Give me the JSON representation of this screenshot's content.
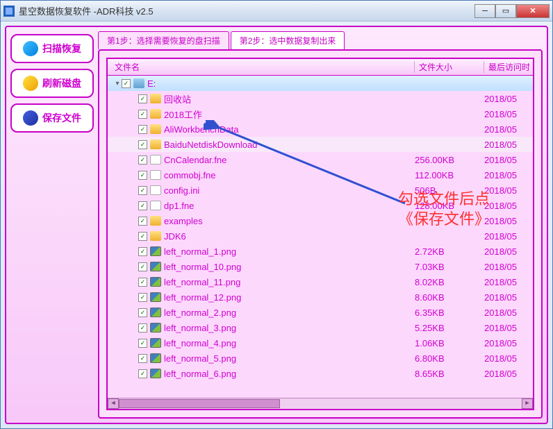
{
  "window": {
    "title": "星空数据恢复软件   -ADR科技 v2.5"
  },
  "sidebar": {
    "buttons": [
      {
        "label": "扫描恢复",
        "icon": "scan-icon",
        "color": "linear-gradient(135deg,#40c0ff,#0080e0)"
      },
      {
        "label": "刷新磁盘",
        "icon": "refresh-icon",
        "color": "linear-gradient(135deg,#ffe040,#f0a000)"
      },
      {
        "label": "保存文件",
        "icon": "save-icon",
        "color": "linear-gradient(135deg,#4060e0,#2030a0)"
      }
    ]
  },
  "tabs": [
    {
      "label": "第1步：选择需要恢复的盘扫描",
      "active": false
    },
    {
      "label": "第2步：选中数据复制出来",
      "active": true
    }
  ],
  "columns": {
    "name": "文件名",
    "size": "文件大小",
    "date": "最后访问时"
  },
  "rows": [
    {
      "indent": 0,
      "expander": "▾",
      "checked": true,
      "icon": "drive",
      "name": "E:",
      "size": "",
      "date": "",
      "root": true
    },
    {
      "indent": 1,
      "expander": "",
      "checked": true,
      "icon": "folder",
      "name": "回收站",
      "size": "",
      "date": "2018/05"
    },
    {
      "indent": 1,
      "expander": "",
      "checked": true,
      "icon": "folder",
      "name": "2018工作",
      "size": "",
      "date": "2018/05"
    },
    {
      "indent": 1,
      "expander": "",
      "checked": true,
      "icon": "folder",
      "name": "AliWorkbenchData",
      "size": "",
      "date": "2018/05"
    },
    {
      "indent": 1,
      "expander": "",
      "checked": true,
      "icon": "folder",
      "name": "BaiduNetdiskDownload",
      "size": "",
      "date": "2018/05",
      "hl": true
    },
    {
      "indent": 1,
      "expander": "",
      "checked": true,
      "icon": "file",
      "name": "CnCalendar.fne",
      "size": "256.00KB",
      "date": "2018/05"
    },
    {
      "indent": 1,
      "expander": "",
      "checked": true,
      "icon": "file",
      "name": "commobj.fne",
      "size": "112.00KB",
      "date": "2018/05"
    },
    {
      "indent": 1,
      "expander": "",
      "checked": true,
      "icon": "file",
      "name": "config.ini",
      "size": "506B",
      "date": "2018/05"
    },
    {
      "indent": 1,
      "expander": "",
      "checked": true,
      "icon": "file",
      "name": "dp1.fne",
      "size": "128.00KB",
      "date": "2018/05"
    },
    {
      "indent": 1,
      "expander": "",
      "checked": true,
      "icon": "folder",
      "name": "examples",
      "size": "",
      "date": "2018/05"
    },
    {
      "indent": 1,
      "expander": "",
      "checked": true,
      "icon": "folder",
      "name": "JDK6",
      "size": "",
      "date": "2018/05"
    },
    {
      "indent": 1,
      "expander": "",
      "checked": true,
      "icon": "img",
      "name": "left_normal_1.png",
      "size": "2.72KB",
      "date": "2018/05"
    },
    {
      "indent": 1,
      "expander": "",
      "checked": true,
      "icon": "img",
      "name": "left_normal_10.png",
      "size": "7.03KB",
      "date": "2018/05"
    },
    {
      "indent": 1,
      "expander": "",
      "checked": true,
      "icon": "img",
      "name": "left_normal_11.png",
      "size": "8.02KB",
      "date": "2018/05"
    },
    {
      "indent": 1,
      "expander": "",
      "checked": true,
      "icon": "img",
      "name": "left_normal_12.png",
      "size": "8.60KB",
      "date": "2018/05"
    },
    {
      "indent": 1,
      "expander": "",
      "checked": true,
      "icon": "img",
      "name": "left_normal_2.png",
      "size": "6.35KB",
      "date": "2018/05"
    },
    {
      "indent": 1,
      "expander": "",
      "checked": true,
      "icon": "img",
      "name": "left_normal_3.png",
      "size": "5.25KB",
      "date": "2018/05"
    },
    {
      "indent": 1,
      "expander": "",
      "checked": true,
      "icon": "img",
      "name": "left_normal_4.png",
      "size": "1.06KB",
      "date": "2018/05"
    },
    {
      "indent": 1,
      "expander": "",
      "checked": true,
      "icon": "img",
      "name": "left_normal_5.png",
      "size": "6.80KB",
      "date": "2018/05"
    },
    {
      "indent": 1,
      "expander": "",
      "checked": true,
      "icon": "img",
      "name": "left_normal_6.png",
      "size": "8.65KB",
      "date": "2018/05"
    }
  ],
  "annotation": {
    "line1": "勾选文件后点",
    "line2": "《保存文件》"
  }
}
